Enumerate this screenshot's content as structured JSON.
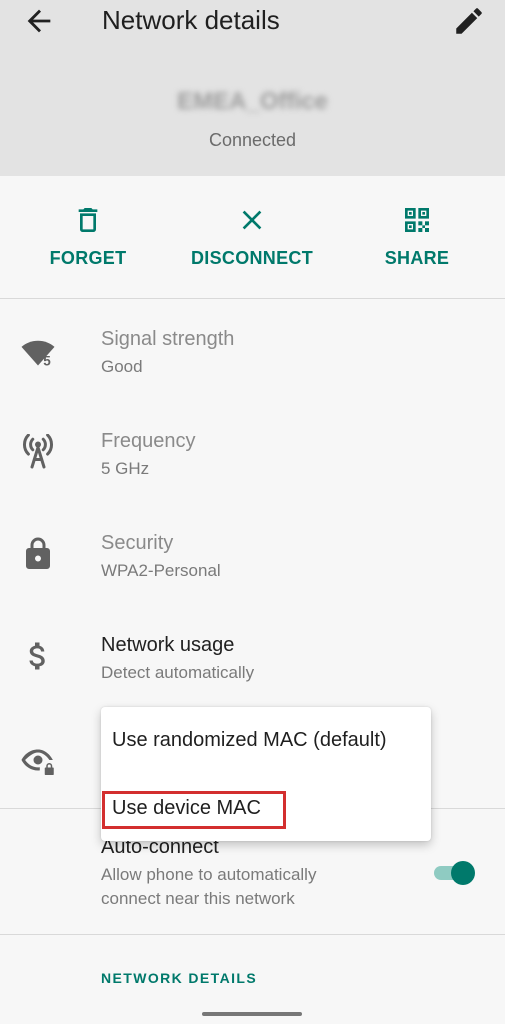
{
  "appbar": {
    "title": "Network details",
    "back_icon": "arrow-back-icon",
    "edit_icon": "pencil-icon"
  },
  "network": {
    "ssid": "EMEA_Office",
    "status": "Connected"
  },
  "actions": [
    {
      "label": "FORGET",
      "icon": "trash-icon"
    },
    {
      "label": "DISCONNECT",
      "icon": "close-icon"
    },
    {
      "label": "SHARE",
      "icon": "qr-code-icon"
    }
  ],
  "details": {
    "signal": {
      "title": "Signal strength",
      "value": "Good",
      "icon": "wifi-signal-icon",
      "badge": "5"
    },
    "frequency": {
      "title": "Frequency",
      "value": "5 GHz",
      "icon": "antenna-icon"
    },
    "security": {
      "title": "Security",
      "value": "WPA2-Personal",
      "icon": "lock-icon"
    },
    "usage": {
      "title": "Network usage",
      "value": "Detect automatically",
      "icon": "dollar-icon"
    },
    "privacy": {
      "icon": "eye-lock-icon"
    }
  },
  "mac_menu": {
    "options": [
      "Use randomized MAC (default)",
      "Use device MAC"
    ],
    "highlighted_index": 1
  },
  "autoconnect": {
    "title": "Auto-connect",
    "line1": "Allow phone to automatically",
    "line2": "connect near this network",
    "enabled": true
  },
  "section": {
    "label": "NETWORK DETAILS"
  },
  "colors": {
    "accent": "#00796b",
    "highlight": "#d32f2f",
    "appbar_bg": "#e3e3e3",
    "page_bg": "#f7f7f7"
  }
}
